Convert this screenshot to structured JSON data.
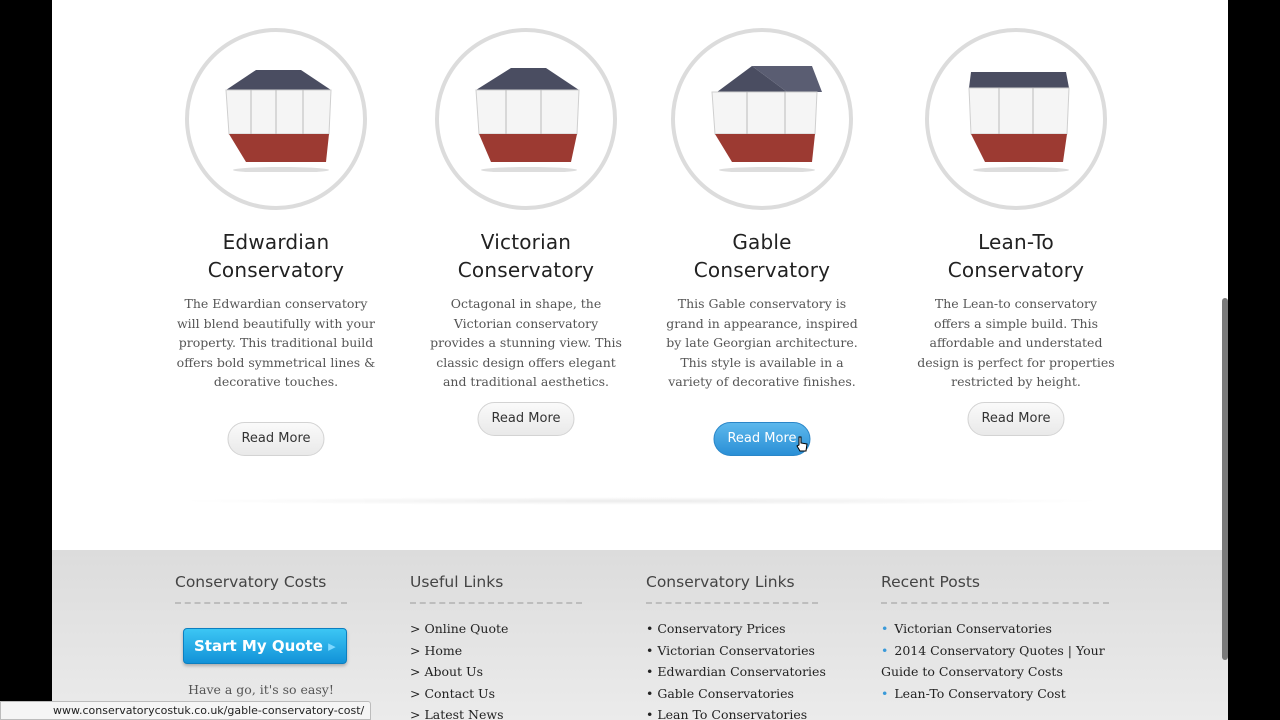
{
  "cards": [
    {
      "title_line1": "Edwardian",
      "title_line2": "Conservatory",
      "description": "The Edwardian conservatory will blend beautifully with your property. This traditional build offers bold symmetrical lines & decorative touches.",
      "button_label": "Read More"
    },
    {
      "title_line1": "Victorian",
      "title_line2": "Conservatory",
      "description": "Octagonal in shape, the Victorian conservatory provides a stunning view. This classic design offers elegant and traditional aesthetics.",
      "button_label": "Read More"
    },
    {
      "title_line1": "Gable",
      "title_line2": "Conservatory",
      "description": "This Gable conservatory is grand in appearance, inspired by late Georgian architecture. This style is available in a variety of decorative finishes.",
      "button_label": "Read More"
    },
    {
      "title_line1": "Lean-To",
      "title_line2": "Conservatory",
      "description": "The Lean-to conservatory offers a simple build. This affordable and understated design is perfect for properties restricted by height.",
      "button_label": "Read More"
    }
  ],
  "footer": {
    "costs": {
      "heading": "Conservatory Costs",
      "quote_label": "Start My Quote",
      "quote_arrow": "▸",
      "tagline": "Have a go, it's so easy!"
    },
    "useful_links": {
      "heading": "Useful Links",
      "items": [
        "> Online Quote",
        "> Home",
        "> About Us",
        "> Contact Us",
        "> Latest News"
      ]
    },
    "conservatory_links": {
      "heading": "Conservatory Links",
      "items": [
        "• Conservatory Prices",
        "• Victorian Conservatories",
        "• Edwardian Conservatories",
        "• Gable Conservatories",
        "• Lean To Conservatories"
      ]
    },
    "recent_posts": {
      "heading": "Recent Posts",
      "items": [
        "Victorian Conservatories",
        "2014 Conservatory Quotes | Your Guide to Conservatory Costs",
        "Lean-To Conservatory Cost"
      ]
    }
  },
  "status_url": "www.conservatorycostuk.co.uk/gable-conservatory-cost/",
  "colors": {
    "accent": "#2a8fd6",
    "quote_button": "#1a9ee0",
    "bullet": "#3a9ad9"
  }
}
